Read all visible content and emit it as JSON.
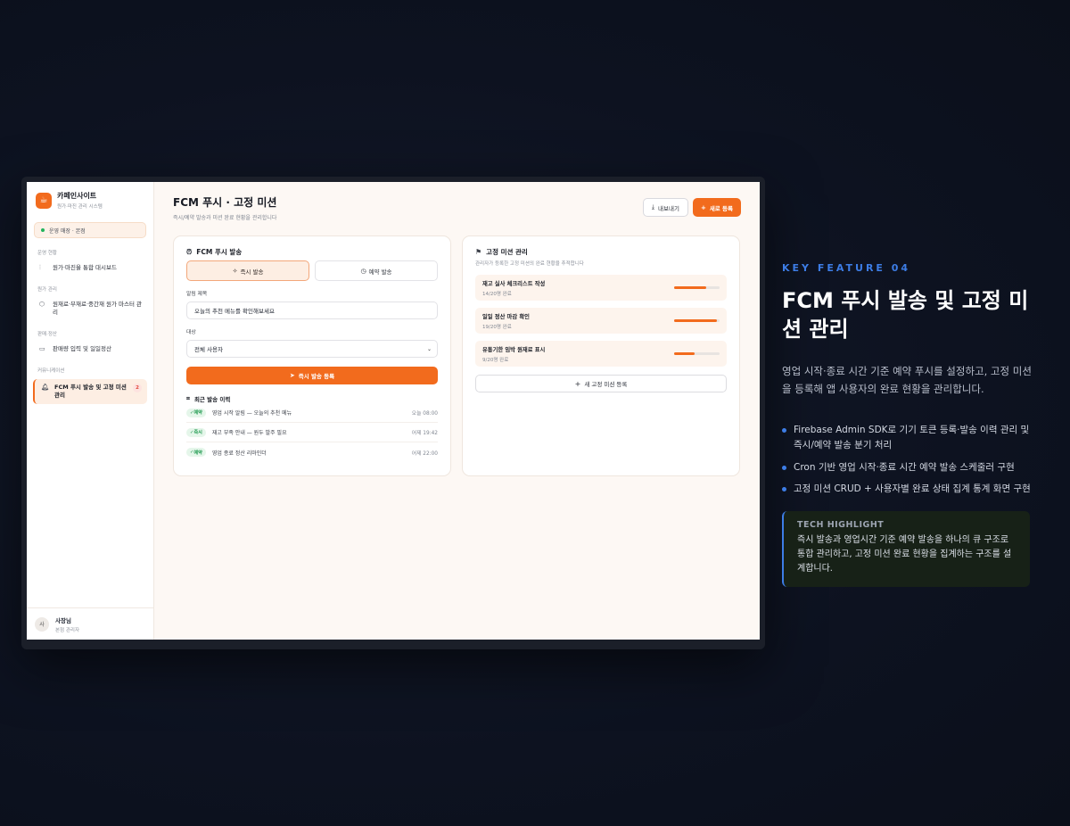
{
  "sidebar": {
    "brand_name": "카페인사이트",
    "brand_sub": "원가·마진 관리 시스템",
    "store": "운영 매장 · 본점",
    "sections": [
      {
        "title": "운영 현황",
        "items": [
          {
            "label": "원가·마진율 통합 대시보드",
            "icon": "chart-icon"
          }
        ]
      },
      {
        "title": "원가 관리",
        "items": [
          {
            "label": "원재료·부재료·중간재 원가 마스터 관리",
            "icon": "box-icon"
          }
        ]
      },
      {
        "title": "판매·정산",
        "items": [
          {
            "label": "판매량 입력 및 일일정산",
            "icon": "wallet-icon"
          }
        ]
      },
      {
        "title": "커뮤니케이션",
        "items": [
          {
            "label": "FCM 푸시 발송 및 고정 미션 관리",
            "icon": "bell-icon",
            "count": "2"
          }
        ]
      }
    ],
    "user": {
      "avatar": "사",
      "name": "사장님",
      "role": "본점 관리자"
    }
  },
  "header": {
    "title": "FCM 푸시 · 고정 미션",
    "subtitle": "즉시/예약 발송과 미션 완료 현황을 관리합니다",
    "export_label": "내보내기",
    "new_label": "새로 등록"
  },
  "push_panel": {
    "title": "FCM 푸시 발송",
    "tabs": [
      "즉시 발송",
      "예약 발송"
    ],
    "title_label": "알림 제목",
    "title_value": "오늘의 추천 메뉴를 확인해보세요",
    "target_label": "대상",
    "target_value": "전체 사용자",
    "send_label": "즉시 발송 등록",
    "history_title": "최근 발송 이력",
    "history": [
      {
        "tag": "예약",
        "text": "영업 시작 알림 — 오늘의 추천 메뉴",
        "time": "오늘 08:00"
      },
      {
        "tag": "즉시",
        "text": "재고 부족 안내 — 원두 발주 필요",
        "time": "어제 19:42"
      },
      {
        "tag": "예약",
        "text": "영업 종료 정산 리마인더",
        "time": "어제 22:00"
      }
    ]
  },
  "mission_panel": {
    "title": "고정 미션 관리",
    "desc": "관리자가 등록한 고정 미션의 완료 현황을 추적합니다",
    "missions": [
      {
        "name": "재고 실사 체크리스트 작성",
        "count": "14/20명 완료",
        "progress": 0.7
      },
      {
        "name": "일일 정산 마감 확인",
        "count": "19/20명 완료",
        "progress": 0.95
      },
      {
        "name": "유통기한 임박 원재료 표시",
        "count": "9/20명 완료",
        "progress": 0.45
      }
    ],
    "add_label": "새 고정 미션 등록"
  },
  "feature": {
    "kicker": "KEY FEATURE 04",
    "title": "FCM 푸시 발송 및 고정 미션 관리",
    "desc": "영업 시작·종료 시간 기준 예약 푸시를 설정하고, 고정 미션을 등록해 앱 사용자의 완료 현황을 관리합니다.",
    "bullets": [
      "Firebase Admin SDK로 기기 토큰 등록·발송 이력 관리 및 즉시/예약 발송 분기 처리",
      "Cron 기반 영업 시작·종료 시간 예약 발송 스케줄러 구현",
      "고정 미션 CRUD + 사용자별 완료 상태 집계 통계 화면 구현"
    ],
    "highlight_label": "TECH HIGHLIGHT",
    "highlight_text": "즉시 발송과 영업시간 기준 예약 발송을 하나의 큐 구조로 통합 관리하고, 고정 미션 완료 현황을 집계하는 구조를 설계합니다."
  },
  "colors": {
    "accent": "#f26b1d",
    "feature_blue": "#3d7de6",
    "success": "#22b35b"
  }
}
